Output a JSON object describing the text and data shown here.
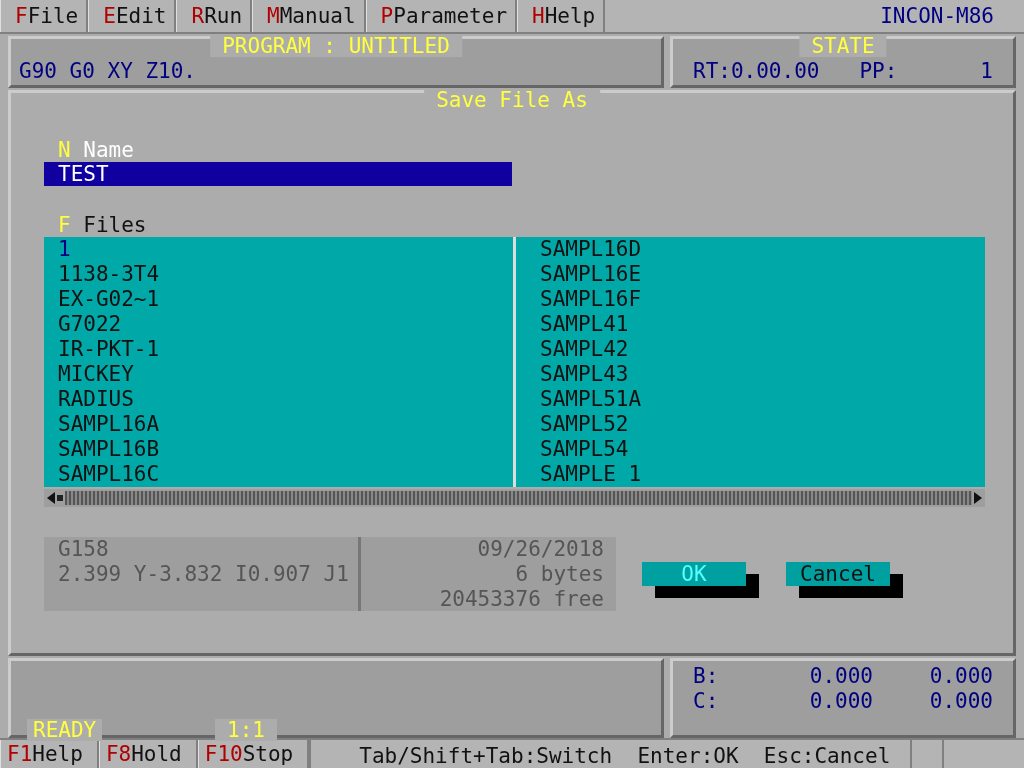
{
  "menu": [
    {
      "key": "F",
      "label": "File"
    },
    {
      "key": "E",
      "label": "Edit"
    },
    {
      "key": "R",
      "label": "Run"
    },
    {
      "key": "M",
      "label": "Manual"
    },
    {
      "key": "P",
      "label": "Parameter"
    },
    {
      "key": "H",
      "label": "Help"
    }
  ],
  "product": "INCON-M86",
  "program_panel": {
    "title": "PROGRAM : UNTITLED",
    "line": "G90 G0 XY Z10."
  },
  "state_panel": {
    "title": "STATE",
    "rt": "RT:0.00.00",
    "pp_label": "PP:",
    "pp_value": "1"
  },
  "dialog": {
    "title": "Save File As",
    "name_field": {
      "key": "N",
      "label": "Name",
      "value": "TEST"
    },
    "files_label": {
      "key": "F",
      "label": "Files"
    },
    "files": [
      {
        "name": "1",
        "selected": true
      },
      {
        "name": "1138-3T4",
        "selected": false
      },
      {
        "name": "EX-G02~1",
        "selected": false
      },
      {
        "name": "G7022",
        "selected": false
      },
      {
        "name": "IR-PKT-1",
        "selected": false
      },
      {
        "name": "MICKEY",
        "selected": false
      },
      {
        "name": "RADIUS",
        "selected": false
      },
      {
        "name": "SAMPL16A",
        "selected": false
      },
      {
        "name": "SAMPL16B",
        "selected": false
      },
      {
        "name": "SAMPL16C",
        "selected": false
      },
      {
        "name": "SAMPL16D",
        "selected": false
      },
      {
        "name": "SAMPL16E",
        "selected": false
      },
      {
        "name": "SAMPL16F",
        "selected": false
      },
      {
        "name": "SAMPL41",
        "selected": false
      },
      {
        "name": "SAMPL42",
        "selected": false
      },
      {
        "name": "SAMPL43",
        "selected": false
      },
      {
        "name": "SAMPL51A",
        "selected": false
      },
      {
        "name": "SAMPL52",
        "selected": false
      },
      {
        "name": "SAMPL54",
        "selected": false
      },
      {
        "name": "SAMPLE 1",
        "selected": false
      }
    ],
    "preview": [
      "G158",
      "2.399 Y-3.832 I0.907 J1"
    ],
    "info": [
      "09/26/2018",
      "6 bytes",
      "20453376 free"
    ],
    "buttons": [
      {
        "label": "OK",
        "focused": true
      },
      {
        "label": "Cancel",
        "focused": false
      }
    ]
  },
  "status_panel": {
    "status": "READY",
    "position": "1:1"
  },
  "axes": [
    {
      "label": "B:",
      "value_1": "0.000",
      "value_2": "0.000"
    },
    {
      "label": "C:",
      "value_1": "0.000",
      "value_2": "0.000"
    }
  ],
  "function_keys": [
    {
      "key": "F1",
      "label": "Help"
    },
    {
      "key": "F8",
      "label": "Hold"
    },
    {
      "key": "F10",
      "label": "Stop"
    }
  ],
  "hint": "Tab/Shift+Tab:Switch  Enter:OK  Esc:Cancel"
}
